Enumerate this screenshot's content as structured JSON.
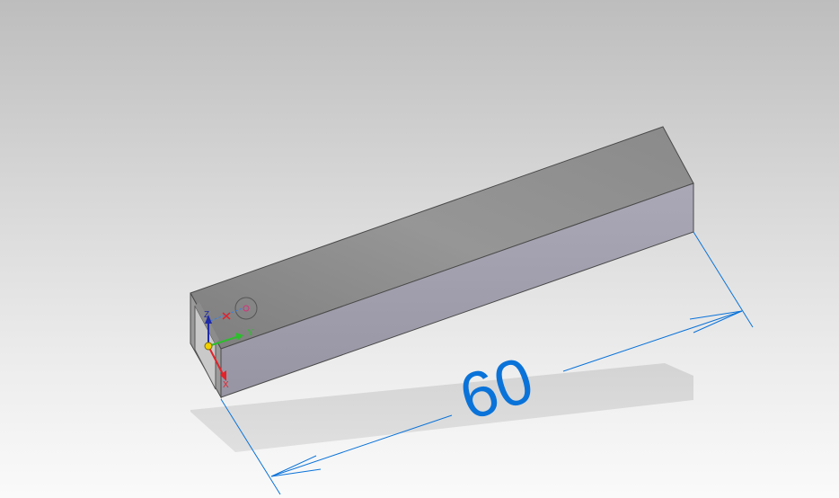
{
  "viewport": {
    "background_top": "#bdbdbd",
    "background_bottom": "#fafafa"
  },
  "model": {
    "name": "rectangular-tube",
    "top_face_color": "#8f8f8f",
    "front_face_color": "#a3a1ae",
    "end_face_color": "#9a9a9a",
    "edge_color": "#4a4a4a"
  },
  "dimension": {
    "value": "60",
    "color": "#0a73d9"
  },
  "triad": {
    "x_label": "X",
    "y_label": "Y",
    "z_label": "Z",
    "x_color": "#e2232a",
    "y_color": "#2bbf2b",
    "z_color": "#1f2aa8",
    "origin_color": "#f3d000"
  }
}
